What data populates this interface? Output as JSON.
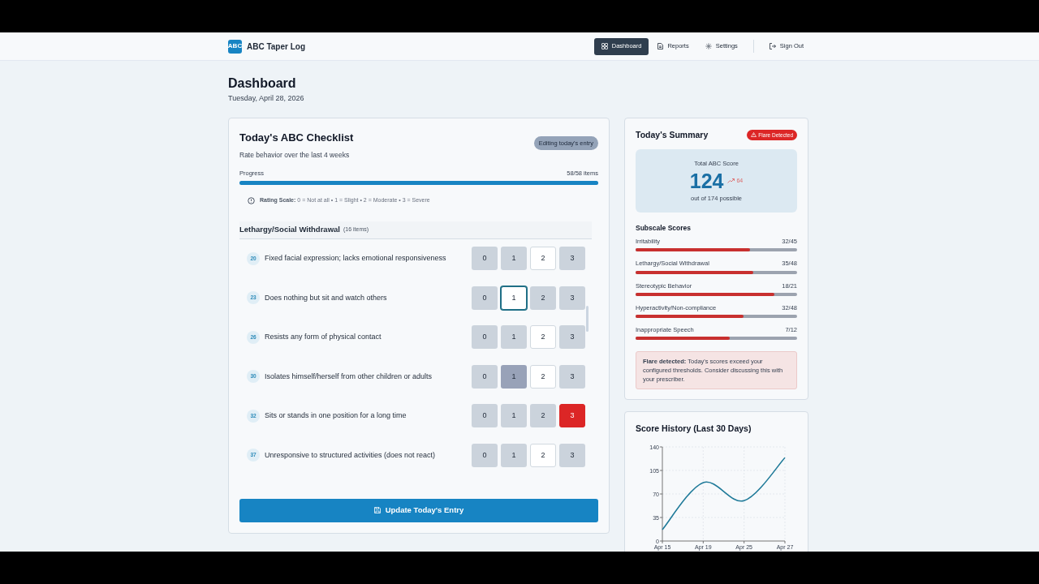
{
  "app": {
    "logo": "ABC",
    "name": "ABC Taper Log"
  },
  "nav": [
    {
      "label": "Dashboard",
      "selected": true
    },
    {
      "label": "Reports",
      "selected": false
    },
    {
      "label": "Settings",
      "selected": false
    },
    {
      "label": "Sign Out",
      "selected": false
    }
  ],
  "page": {
    "title": "Dashboard",
    "date": "Tuesday, April 28, 2026"
  },
  "checklist": {
    "title": "Today's ABC Checklist",
    "subtitle": "Rate behavior over the last 4 weeks",
    "badge": "Editing today's entry",
    "progress_label": "Progress",
    "progress_count": "58/58 items",
    "level": 1,
    "scale_label": "Rating Scale:",
    "scale_text": "0 = Not at all • 1 = Slight • 2 = Moderate • 3 = Severe",
    "section": "Lethargy/Social Withdrawal",
    "section_count": "(16 items)",
    "items": [
      {
        "number": "20",
        "text": "Fixed facial expression; lacks emotional responsiveness",
        "options": [
          {
            "label": "0",
            "selected": false,
            "focused": false,
            "hovered": false
          },
          {
            "label": "1",
            "selected": false,
            "focused": false,
            "hovered": false
          },
          {
            "label": "2",
            "selected": true,
            "focused": false,
            "hovered": false
          },
          {
            "label": "3",
            "selected": false,
            "focused": false,
            "hovered": false
          }
        ]
      },
      {
        "number": "23",
        "text": "Does nothing but sit and watch others",
        "options": [
          {
            "label": "0",
            "selected": false,
            "focused": false,
            "hovered": false
          },
          {
            "label": "1",
            "selected": true,
            "focused": true,
            "hovered": false
          },
          {
            "label": "2",
            "selected": false,
            "focused": false,
            "hovered": false
          },
          {
            "label": "3",
            "selected": false,
            "focused": false,
            "hovered": false
          }
        ]
      },
      {
        "number": "26",
        "text": "Resists any form of physical contact",
        "options": [
          {
            "label": "0",
            "selected": false,
            "focused": false,
            "hovered": false
          },
          {
            "label": "1",
            "selected": false,
            "focused": false,
            "hovered": false
          },
          {
            "label": "2",
            "selected": true,
            "focused": false,
            "hovered": false
          },
          {
            "label": "3",
            "selected": false,
            "focused": false,
            "hovered": false
          }
        ]
      },
      {
        "number": "30",
        "text": "Isolates himself/herself from other children or adults",
        "options": [
          {
            "label": "0",
            "selected": false,
            "focused": false,
            "hovered": false
          },
          {
            "label": "1",
            "selected": false,
            "focused": false,
            "hovered": true
          },
          {
            "label": "2",
            "selected": true,
            "focused": false,
            "hovered": false
          },
          {
            "label": "3",
            "selected": false,
            "focused": false,
            "hovered": false
          }
        ]
      },
      {
        "number": "32",
        "text": "Sits or stands in one position for a long time",
        "options": [
          {
            "label": "0",
            "selected": false,
            "focused": false,
            "hovered": false
          },
          {
            "label": "1",
            "selected": false,
            "focused": false,
            "hovered": false
          },
          {
            "label": "2",
            "selected": false,
            "focused": false,
            "hovered": false
          },
          {
            "label": "3",
            "selected": true,
            "focused": false,
            "hovered": false
          }
        ]
      },
      {
        "number": "37",
        "text": "Unresponsive to structured activities (does not react)",
        "options": [
          {
            "label": "0",
            "selected": false,
            "focused": false,
            "hovered": false
          },
          {
            "label": "1",
            "selected": false,
            "focused": false,
            "hovered": false
          },
          {
            "label": "2",
            "selected": true,
            "focused": false,
            "hovered": false
          },
          {
            "label": "3",
            "selected": false,
            "focused": false,
            "hovered": false
          }
        ]
      }
    ],
    "submit": "Update Today's Entry"
  },
  "summary": {
    "title": "Today's Summary",
    "flag": "Flare Detected",
    "total_label": "Total ABC Score",
    "total": "124",
    "change": "64",
    "out_of": "out of 174 possible",
    "subscale_title": "Subscale Scores",
    "subscales": [
      {
        "name": "Irritability",
        "score": "32/45",
        "level": 0.711
      },
      {
        "name": "Lethargy/Social Withdrawal",
        "score": "35/48",
        "level": 0.729
      },
      {
        "name": "Stereotypic Behavior",
        "score": "18/21",
        "level": 0.857
      },
      {
        "name": "Hyperactivity/Non-compliance",
        "score": "32/48",
        "level": 0.667
      },
      {
        "name": "Inappropriate Speech",
        "score": "7/12",
        "level": 0.583
      }
    ],
    "alert": "**Flare detected:** Today's scores exceed your configured thresholds. Consider discussing this with your prescriber."
  },
  "history": {
    "title": "Score History (Last 30 Days)",
    "chart_data": {
      "type": "line",
      "categories": [
        "Apr 15",
        "Apr 19",
        "Apr 25",
        "Apr 27"
      ],
      "series": [
        {
          "color": "#1f7a99",
          "values": [
            17,
            87,
            60,
            124
          ]
        }
      ],
      "ylim": [
        0,
        140
      ],
      "yticks": [
        0,
        35,
        70,
        105,
        140
      ],
      "grid": true
    }
  }
}
